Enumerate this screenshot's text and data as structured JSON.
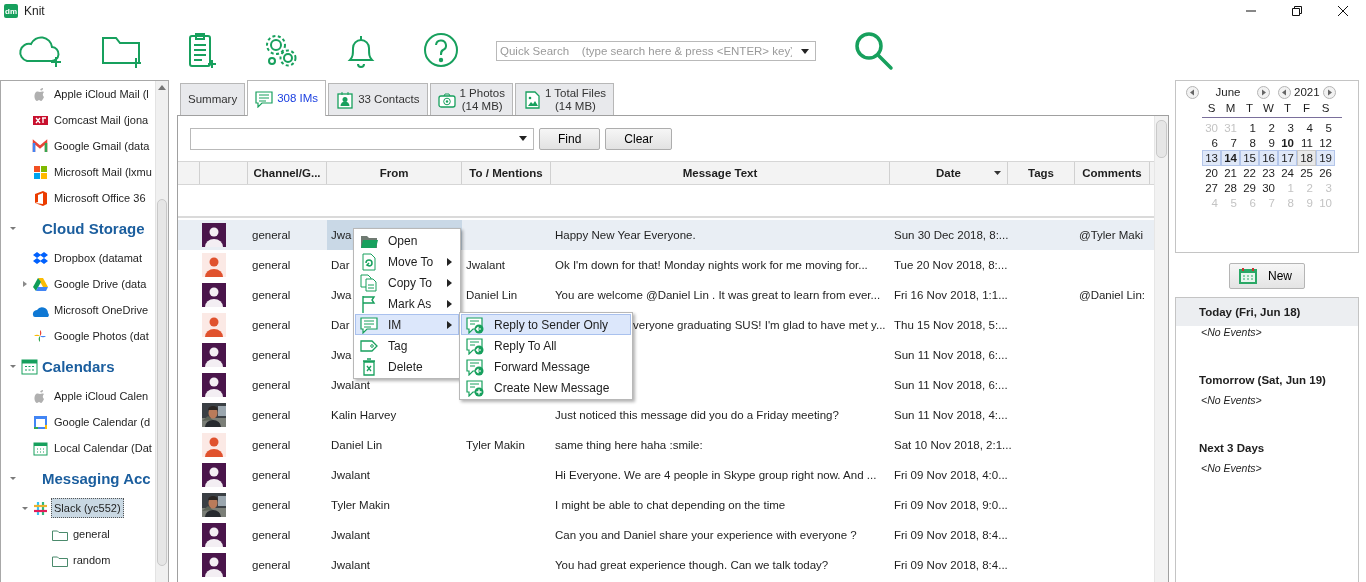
{
  "window": {
    "logo": "dm",
    "title": "Knit"
  },
  "toolbar": {
    "search": {
      "placeholder": "Quick Search    (type search here & press <ENTER> key)"
    }
  },
  "sidebar": {
    "sections": [
      {
        "items": [
          {
            "label": "Apple iCloud Mail (l",
            "selected": false
          },
          {
            "label": "Comcast Mail (jona",
            "selected": false
          },
          {
            "label": "Google Gmail (data",
            "selected": false
          },
          {
            "label": "Microsoft Mail (lxmu",
            "selected": false
          },
          {
            "label": "Microsoft Office 36",
            "selected": false
          }
        ]
      },
      {
        "title": "Cloud Storage",
        "expanded": true,
        "items": [
          {
            "label": "Dropbox (datamat",
            "selected": false
          },
          {
            "label": "Google Drive (data",
            "expanded": false,
            "selected": false
          },
          {
            "label": "Microsoft OneDrive",
            "selected": false
          },
          {
            "label": "Google Photos (dat",
            "selected": false
          }
        ]
      },
      {
        "title": "Calendars",
        "expanded": true,
        "items": [
          {
            "label": "Apple iCloud Calen",
            "selected": false
          },
          {
            "label": "Google Calendar (d",
            "selected": false
          },
          {
            "label": "Local Calendar (Dat",
            "selected": false
          }
        ]
      },
      {
        "title": "Messaging Acc",
        "expanded": true,
        "items": [
          {
            "label": "Slack (yc552)",
            "expanded": true,
            "selected": true,
            "children": [
              {
                "label": "general",
                "selected": false
              },
              {
                "label": "random",
                "selected": false
              }
            ]
          }
        ]
      }
    ]
  },
  "tabs": [
    {
      "label": "Summary",
      "selected": false
    },
    {
      "label": "308 IMs",
      "selected": true
    },
    {
      "label": "33 Contacts",
      "selected": false
    },
    {
      "label": "1 Photos",
      "sublabel": "(14 MB)",
      "selected": false
    },
    {
      "label": "1 Total Files",
      "sublabel": "(14 MB)",
      "selected": false
    }
  ],
  "filter": {
    "buttons": [
      "Find",
      "Clear"
    ]
  },
  "table": {
    "columns": [
      {
        "label": "Channel/G...",
        "sorted": false
      },
      {
        "label": "From",
        "sorted": false
      },
      {
        "label": "To / Mentions",
        "sorted": false
      },
      {
        "label": "Message Text",
        "sorted": false
      },
      {
        "label": "Date",
        "sorted": true
      },
      {
        "label": "Tags",
        "sorted": false
      },
      {
        "label": "Comments",
        "sorted": false
      }
    ],
    "rows": [
      {
        "avatar": {
          "kind": "filled",
          "color": "#4a154b"
        },
        "channel": "general",
        "from": "Jwa",
        "message": "Happy New Year Everyone.",
        "date": "Sun 30 Dec 2018, 8:...",
        "comments": "@Tyler Maki",
        "selected": true
      },
      {
        "avatar": {
          "kind": "outline",
          "color": "#e0522e"
        },
        "channel": "general",
        "from": "Dar",
        "to": "Jwalant",
        "message": "Ok I'm down for that! Monday nights work for me moving for...",
        "date": "Tue 20 Nov 2018, 8:...",
        "selected": false
      },
      {
        "avatar": {
          "kind": "filled",
          "color": "#4a154b"
        },
        "channel": "general",
        "from": "Jwa",
        "to": "Daniel Lin",
        "message": "You are welcome @Daniel Lin . It was great to learn from ever...",
        "date": "Fri 16 Nov 2018, 1:1...",
        "comments": "@Daniel Lin:",
        "selected": false
      },
      {
        "avatar": {
          "kind": "outline",
          "color": "#e0522e"
        },
        "channel": "general",
        "from": "Dar",
        "message": "veryone graduating SUS! I'm glad to have met y...",
        "date": "Thu 15 Nov 2018, 5:...",
        "selected": false
      },
      {
        "avatar": {
          "kind": "filled",
          "color": "#4a154b"
        },
        "channel": "general",
        "from": "Jwa",
        "date": "Sun 11 Nov 2018, 6:...",
        "selected": false
      },
      {
        "avatar": {
          "kind": "filled",
          "color": "#4a154b"
        },
        "channel": "general",
        "from": "Jwalant",
        "date": "Sun 11 Nov 2018, 6:...",
        "selected": false
      },
      {
        "channel": "general",
        "from": "Kalin Harvey",
        "message": "Just noticed this message did you do a Friday meeting?",
        "date": "Sun 11 Nov 2018, 4:...",
        "selected": false
      },
      {
        "avatar": {
          "kind": "outline",
          "color": "#e0522e"
        },
        "channel": "general",
        "from": "Daniel Lin",
        "to": "Tyler Makin",
        "message": "same thing here haha :smile:",
        "date": "Sat 10 Nov 2018, 2:1...",
        "selected": false
      },
      {
        "avatar": {
          "kind": "filled",
          "color": "#4a154b"
        },
        "channel": "general",
        "from": "Jwalant",
        "message": "Hi Everyone. We are 4 people in Skype group right now. And ...",
        "date": "Fri 09 Nov 2018, 4:0...",
        "selected": false
      },
      {
        "channel": "general",
        "from": "Tyler Makin",
        "message": "I might be able to chat depending on the time",
        "date": "Fri 09 Nov 2018, 9:0...",
        "selected": false
      },
      {
        "avatar": {
          "kind": "filled",
          "color": "#4a154b"
        },
        "channel": "general",
        "from": "Jwalant",
        "message": "Can you and Daniel share your experience with everyone ?",
        "date": "Fri 09 Nov 2018, 8:4...",
        "selected": false
      },
      {
        "avatar": {
          "kind": "filled",
          "color": "#4a154b"
        },
        "channel": "general",
        "from": "Jwalant",
        "message": "You had great experience though. Can we talk today?",
        "date": "Fri 09 Nov 2018, 8:4...",
        "selected": false
      }
    ]
  },
  "context_menu": {
    "items": [
      {
        "label": "Open",
        "submenu": false,
        "selected": false
      },
      {
        "label": "Move To",
        "submenu": true,
        "selected": false
      },
      {
        "label": "Copy To",
        "submenu": true,
        "selected": false
      },
      {
        "label": "Mark As",
        "submenu": true,
        "selected": false
      },
      {
        "label": "IM",
        "submenu": true,
        "selected": true
      },
      {
        "label": "Tag",
        "submenu": false,
        "selected": false
      },
      {
        "label": "Delete",
        "submenu": false,
        "selected": false
      }
    ],
    "submenu": {
      "items": [
        {
          "label": "Reply to Sender Only",
          "selected": true
        },
        {
          "label": "Reply To All",
          "selected": false
        },
        {
          "label": "Forward Message",
          "selected": false
        },
        {
          "label": "Create New Message",
          "selected": false
        }
      ]
    }
  },
  "calendar": {
    "month": "June",
    "year": "2021",
    "weekdays": [
      "S",
      "M",
      "T",
      "W",
      "T",
      "F",
      "S"
    ],
    "weeks": [
      {
        "selected": false,
        "days": [
          {
            "day": "30",
            "muted": true,
            "bold": false,
            "today": false
          },
          {
            "day": "31",
            "muted": true,
            "bold": false,
            "today": false
          },
          {
            "day": "1",
            "muted": false,
            "bold": false,
            "today": false
          },
          {
            "day": "2",
            "muted": false,
            "bold": false,
            "today": false
          },
          {
            "day": "3",
            "muted": false,
            "bold": false,
            "today": false
          },
          {
            "day": "4",
            "muted": false,
            "bold": false,
            "today": false
          },
          {
            "day": "5",
            "muted": false,
            "bold": false,
            "today": false
          }
        ]
      },
      {
        "selected": false,
        "days": [
          {
            "day": "6",
            "muted": false,
            "bold": false,
            "today": false
          },
          {
            "day": "7",
            "muted": false,
            "bold": false,
            "today": false
          },
          {
            "day": "8",
            "muted": false,
            "bold": false,
            "today": false
          },
          {
            "day": "9",
            "muted": false,
            "bold": false,
            "today": false
          },
          {
            "day": "10",
            "muted": false,
            "bold": true,
            "today": false
          },
          {
            "day": "11",
            "muted": false,
            "bold": false,
            "today": false
          },
          {
            "day": "12",
            "muted": false,
            "bold": false,
            "today": false
          }
        ]
      },
      {
        "selected": true,
        "days": [
          {
            "day": "13",
            "muted": false,
            "bold": false,
            "today": false
          },
          {
            "day": "14",
            "muted": false,
            "bold": true,
            "today": false
          },
          {
            "day": "15",
            "muted": false,
            "bold": false,
            "today": false
          },
          {
            "day": "16",
            "muted": false,
            "bold": false,
            "today": false
          },
          {
            "day": "17",
            "muted": false,
            "bold": false,
            "today": false
          },
          {
            "day": "18",
            "muted": false,
            "bold": false,
            "today": true
          },
          {
            "day": "19",
            "muted": false,
            "bold": false,
            "today": false
          }
        ]
      },
      {
        "selected": false,
        "days": [
          {
            "day": "20",
            "muted": false,
            "bold": false,
            "today": false
          },
          {
            "day": "21",
            "muted": false,
            "bold": false,
            "today": false
          },
          {
            "day": "22",
            "muted": false,
            "bold": false,
            "today": false
          },
          {
            "day": "23",
            "muted": false,
            "bold": false,
            "today": false
          },
          {
            "day": "24",
            "muted": false,
            "bold": false,
            "today": false
          },
          {
            "day": "25",
            "muted": false,
            "bold": false,
            "today": false
          },
          {
            "day": "26",
            "muted": false,
            "bold": false,
            "today": false
          }
        ]
      },
      {
        "selected": false,
        "days": [
          {
            "day": "27",
            "muted": false,
            "bold": false,
            "today": false
          },
          {
            "day": "28",
            "muted": false,
            "bold": false,
            "today": false
          },
          {
            "day": "29",
            "muted": false,
            "bold": false,
            "today": false
          },
          {
            "day": "30",
            "muted": false,
            "bold": false,
            "today": false
          },
          {
            "day": "1",
            "muted": true,
            "bold": false,
            "today": false
          },
          {
            "day": "2",
            "muted": true,
            "bold": false,
            "today": false
          },
          {
            "day": "3",
            "muted": true,
            "bold": false,
            "today": false
          }
        ]
      },
      {
        "selected": false,
        "days": [
          {
            "day": "4",
            "muted": true,
            "bold": false,
            "today": false
          },
          {
            "day": "5",
            "muted": true,
            "bold": false,
            "today": false
          },
          {
            "day": "6",
            "muted": true,
            "bold": false,
            "today": false
          },
          {
            "day": "7",
            "muted": true,
            "bold": false,
            "today": false
          },
          {
            "day": "8",
            "muted": true,
            "bold": false,
            "today": false
          },
          {
            "day": "9",
            "muted": true,
            "bold": false,
            "today": false
          },
          {
            "day": "10",
            "muted": true,
            "bold": false,
            "today": false
          }
        ]
      }
    ]
  },
  "new_button": "New",
  "agenda": [
    {
      "title": "Today (Fri, Jun 18)",
      "selected": true,
      "empty_text": "<No Events>"
    },
    {
      "title": "Tomorrow (Sat, Jun 19)",
      "selected": false,
      "empty_text": "<No Events>"
    },
    {
      "title": "Next 3 Days",
      "selected": false,
      "empty_text": "<No Events>"
    }
  ]
}
